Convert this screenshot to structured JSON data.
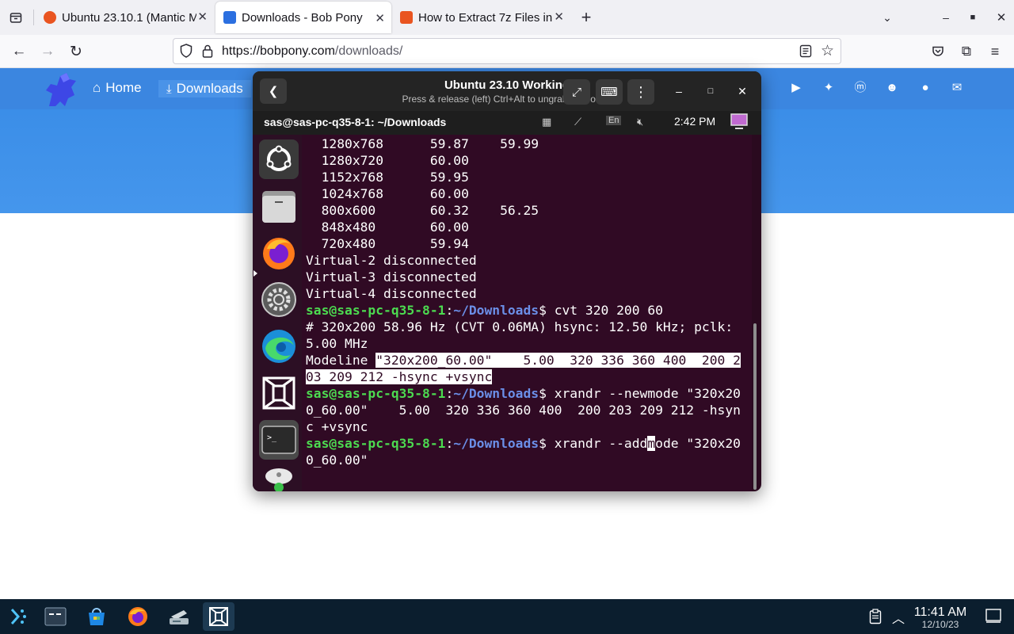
{
  "browser": {
    "tabs": [
      {
        "label": "Ubuntu 23.10.1 (Mantic Mi",
        "favicon": "ubuntu-icon",
        "active": false
      },
      {
        "label": "Downloads - Bob Pony",
        "favicon": "bobpony-icon",
        "active": true
      },
      {
        "label": "How to Extract 7z Files in",
        "favicon": "ubuntu-icon",
        "active": false
      }
    ],
    "url": {
      "host": "https://bobpony.com",
      "path": "/downloads/"
    }
  },
  "site": {
    "nav": [
      {
        "label": "Home",
        "icon": "home-icon"
      },
      {
        "label": "Downloads",
        "icon": "download-icon"
      }
    ],
    "social_icons": [
      "youtube-icon",
      "twitter-icon",
      "mastodon-icon",
      "discord-icon",
      "github-icon",
      "mail-icon"
    ],
    "hero_color": "#3b8ee8"
  },
  "vm": {
    "title": "Ubuntu 23.10 Working",
    "subtitle": "Press & release (left) Ctrl+Alt to ungrab keyboard.",
    "guest_window_title": "sas@sas-pc-q35-8-1: ~/Downloads",
    "guest_time": "2:42 PM",
    "guest_keyboard": "En"
  },
  "terminal": {
    "modes": [
      {
        "res": "1280x768",
        "rates": "59.87    59.99"
      },
      {
        "res": "1280x720",
        "rates": "60.00"
      },
      {
        "res": "1152x768",
        "rates": "59.95"
      },
      {
        "res": "1024x768",
        "rates": "60.00"
      },
      {
        "res": "800x600",
        "rates": "60.32    56.25"
      },
      {
        "res": "848x480",
        "rates": "60.00"
      },
      {
        "res": "720x480",
        "rates": "59.94"
      }
    ],
    "disconnected": [
      "Virtual-2 disconnected",
      "Virtual-3 disconnected",
      "Virtual-4 disconnected"
    ],
    "prompt_user": "sas@sas-pc-q35-8-1",
    "prompt_colon": ":",
    "prompt_path": "~/Downloads",
    "prompt_dollar": "$ ",
    "cmd1": "cvt 320 200 60",
    "out1a": "# 320x200 58.96 Hz (CVT 0.06MA) hsync: 12.50 kHz; pclk:",
    "out1b": "5.00 MHz",
    "modeline_word": "Modeline ",
    "modeline_sel_a": "\"320x200_60.00\"    5.00  320 336 360 400  200 2",
    "modeline_sel_b": "03 209 212 -hsync +vsync",
    "cmd2a": "xrandr --newmode \"320x20",
    "cmd2b": "0_60.00\"    5.00  320 336 360 400  200 203 209 212 -hsyn",
    "cmd2c": "c +vsync",
    "cmd3_pre": "xrandr --add",
    "cmd3_cursor": "m",
    "cmd3_post": "ode \"320x20",
    "cmd3b": "0_60.00\""
  },
  "taskbar": {
    "time": "11:41 AM",
    "date": "12/10/23"
  }
}
